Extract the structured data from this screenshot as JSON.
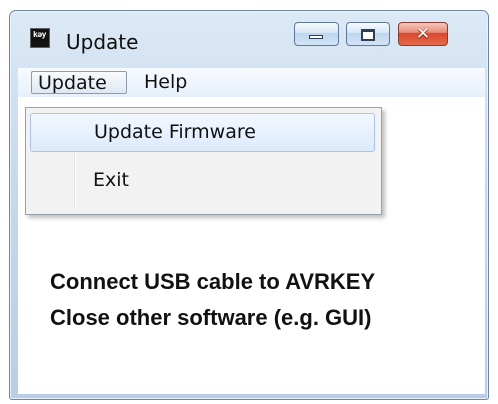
{
  "window": {
    "title": "Update",
    "app_icon_text": "kəy",
    "close_symbol": "✕"
  },
  "menu": {
    "items": [
      {
        "label": "Update"
      },
      {
        "label": "Help"
      }
    ],
    "dropdown": {
      "items": [
        {
          "label": "Update Firmware"
        },
        {
          "label": "Exit"
        }
      ]
    }
  },
  "content": {
    "lines": [
      "Connect USB cable to AVRKEY",
      "Close other software (e.g. GUI)"
    ]
  },
  "colors": {
    "title_bar": "#c8d9ec",
    "close_button": "#d9462b",
    "menu_highlight": "#dceafb"
  }
}
